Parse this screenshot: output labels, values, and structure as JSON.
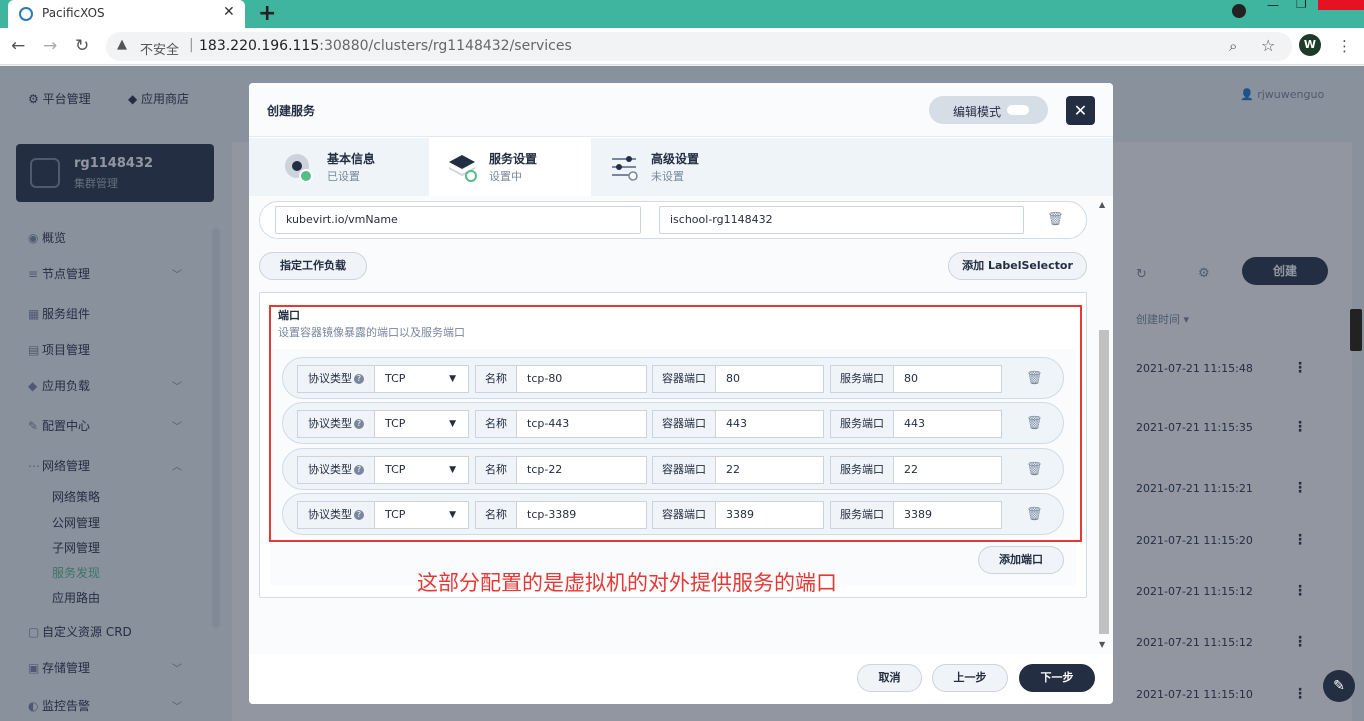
{
  "browser": {
    "tab_title": "PacificXOS",
    "tab_close": "✕",
    "new_tab": "+",
    "security_label": "不安全",
    "url_host": "183.220.196.115",
    "url_rest": ":30880/clusters/rg1148432/services",
    "profile_initial": "W"
  },
  "topnav": {
    "platform": "平台管理",
    "appstore": "应用商店",
    "username": "rjwuwenguo"
  },
  "cluster": {
    "name": "rg1148432",
    "subtitle": "集群管理"
  },
  "sidebar": {
    "items": [
      {
        "label": "概览"
      },
      {
        "label": "节点管理"
      },
      {
        "label": "服务组件"
      },
      {
        "label": "项目管理"
      },
      {
        "label": "应用负载"
      },
      {
        "label": "配置中心"
      },
      {
        "label": "网络管理"
      },
      {
        "label": "自定义资源 CRD"
      },
      {
        "label": "存储管理"
      },
      {
        "label": "监控告警"
      }
    ],
    "network_sub": [
      "网络策略",
      "公网管理",
      "子网管理",
      "服务发现",
      "应用路由"
    ]
  },
  "list": {
    "create_label": "创建",
    "sort_header": "创建时间 ▾",
    "times": [
      "2021-07-21 11:15:48",
      "2021-07-21 11:15:35",
      "2021-07-21 11:15:21",
      "2021-07-21 11:15:20",
      "2021-07-21 11:15:12",
      "2021-07-21 11:15:12",
      "2021-07-21 11:15:10"
    ]
  },
  "modal": {
    "title": "创建服务",
    "edit_mode": "编辑模式",
    "close": "✕",
    "steps": [
      {
        "title": "基本信息",
        "status": "已设置"
      },
      {
        "title": "服务设置",
        "status": "设置中"
      },
      {
        "title": "高级设置",
        "status": "未设置"
      }
    ],
    "label_key": "kubevirt.io/vmName",
    "label_value": "ischool-rg1148432",
    "assign_workload": "指定工作负载",
    "add_label_selector": "添加 LabelSelector",
    "ports_title": "端口",
    "ports_desc": "设置容器镜像暴露的端口以及服务端口",
    "labels": {
      "protocol": "协议类型",
      "name": "名称",
      "container_port": "容器端口",
      "service_port": "服务端口",
      "help": "?"
    },
    "ports": [
      {
        "protocol": "TCP",
        "name": "tcp-80",
        "container_port": "80",
        "service_port": "80"
      },
      {
        "protocol": "TCP",
        "name": "tcp-443",
        "container_port": "443",
        "service_port": "443"
      },
      {
        "protocol": "TCP",
        "name": "tcp-22",
        "container_port": "22",
        "service_port": "22"
      },
      {
        "protocol": "TCP",
        "name": "tcp-3389",
        "container_port": "3389",
        "service_port": "3389"
      }
    ],
    "add_port": "添加端口",
    "annotation": "这部分配置的是虚拟机的对外提供服务的端口",
    "cancel": "取消",
    "prev": "上一步",
    "next": "下一步"
  },
  "colors": {
    "accent": "#55bc8a",
    "dark": "#242e42",
    "annotation": "#e53935",
    "tabbar": "#3fb59f"
  }
}
